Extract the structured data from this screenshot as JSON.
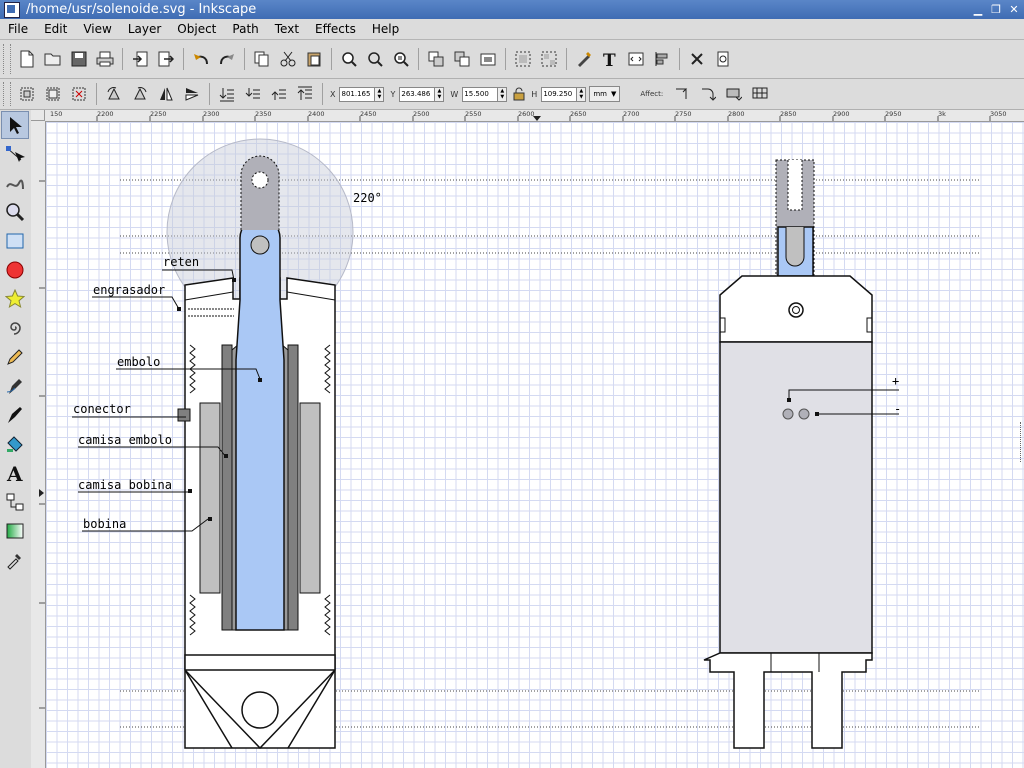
{
  "window": {
    "title": "/home/usr/solenoide.svg - Inkscape"
  },
  "menu": [
    "File",
    "Edit",
    "View",
    "Layer",
    "Object",
    "Path",
    "Text",
    "Effects",
    "Help"
  ],
  "toolbar2": {
    "x": {
      "label": "X",
      "value": "801.165"
    },
    "y": {
      "label": "Y",
      "value": "263.486"
    },
    "w": {
      "label": "W",
      "value": "15.500"
    },
    "h": {
      "label": "H",
      "value": "109.250"
    },
    "unit": "mm",
    "affect": "Affect:"
  },
  "ruler": {
    "h_ticks": [
      "150",
      "2200",
      "2250",
      "2300",
      "2350",
      "2400",
      "2450",
      "2500",
      "2550",
      "2600",
      "2650",
      "2700",
      "2750",
      "2800",
      "2850",
      "2900",
      "2950",
      "3k",
      "3050"
    ]
  },
  "drawing": {
    "angle": "220°",
    "labels": {
      "reten": "reten",
      "engrasador": "engrasador",
      "embolo": "embolo",
      "conector": "conector",
      "camisa_embolo": "camisa embolo",
      "camisa_bobina": "camisa bobina",
      "bobina": "bobina"
    },
    "plus": "+",
    "minus": "-"
  },
  "colors": {
    "accent": "#aac8f5",
    "gray_dark": "#808080",
    "gray_light": "#c0c0c0",
    "body": "#e0e0e6",
    "grid": "#d4daf2"
  }
}
